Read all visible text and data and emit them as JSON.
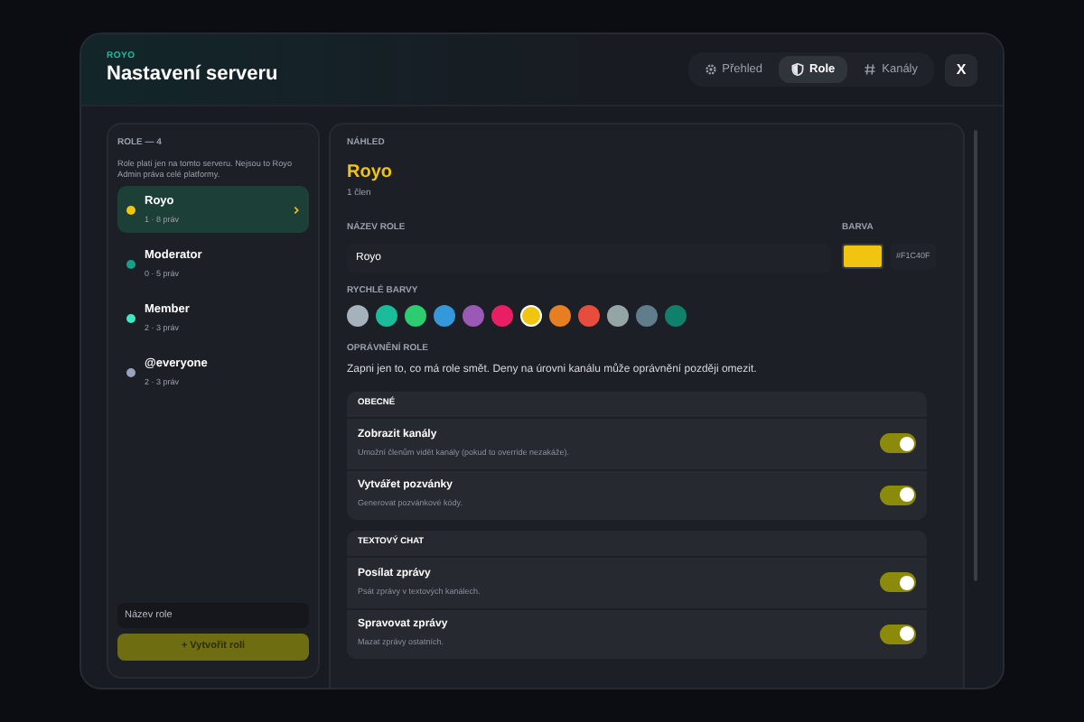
{
  "header": {
    "overline": "ROYO",
    "title": "Nastavení serveru"
  },
  "tabs": [
    {
      "label": "Přehled",
      "selected": false
    },
    {
      "label": "Role",
      "selected": true
    },
    {
      "label": "Kanály",
      "selected": false
    }
  ],
  "close": "X",
  "sidebar": {
    "heading": "ROLE — 4",
    "description": "Role platí jen na tomto serveru. Nejsou to Royo Admin práva celé platformy.",
    "roles": [
      {
        "name": "Royo",
        "meta": "1 · 8 práv",
        "color": "#f1c40f",
        "selected": true
      },
      {
        "name": "Moderator",
        "meta": "0 · 5 práv",
        "color": "#16a085",
        "selected": false
      },
      {
        "name": "Member",
        "meta": "2 · 3 práv",
        "color": "#3ee8c0",
        "selected": false
      },
      {
        "name": "@everyone",
        "meta": "2 · 3 práv",
        "color": "#99a3bd",
        "selected": false
      }
    ],
    "new_role": {
      "placeholder": "Název role"
    },
    "create_button": "+ Vytvořit roli"
  },
  "preview": {
    "label": "NÁHLED",
    "name": "Royo",
    "members": "1 člen"
  },
  "name_field": {
    "label": "NÁZEV ROLE",
    "value": "Royo"
  },
  "color_field": {
    "label": "BARVA",
    "hex": "#F1C40F"
  },
  "quick_colors": {
    "label": "RYCHLÉ BARVY",
    "swatches": [
      {
        "color": "#a5b1bd",
        "selected": false
      },
      {
        "color": "#1abc9c",
        "selected": false
      },
      {
        "color": "#2ecc71",
        "selected": false
      },
      {
        "color": "#3498db",
        "selected": false
      },
      {
        "color": "#9b59b6",
        "selected": false
      },
      {
        "color": "#e91e63",
        "selected": false
      },
      {
        "color": "#f1c40f",
        "selected": true
      },
      {
        "color": "#e67e22",
        "selected": false
      },
      {
        "color": "#e74c3c",
        "selected": false
      },
      {
        "color": "#95a5a6",
        "selected": false
      },
      {
        "color": "#607d8b",
        "selected": false
      },
      {
        "color": "#11806a",
        "selected": false
      }
    ]
  },
  "permissions": {
    "label": "OPRÁVNĚNÍ ROLE",
    "description": "Zapni jen to, co má role smět. Deny na úrovni kanálu může oprávnění později omezit.",
    "groups": [
      {
        "title": "OBECNÉ",
        "items": [
          {
            "name": "Zobrazit kanály",
            "description": "Umožní členům vidět kanály (pokud to override nezakáže).",
            "on": true
          },
          {
            "name": "Vytvářet pozvánky",
            "description": "Generovat pozvánkové kódy.",
            "on": true
          }
        ]
      },
      {
        "title": "TEXTOVÝ CHAT",
        "items": [
          {
            "name": "Posílat zprávy",
            "description": "Psát zprávy v textových kanálech.",
            "on": true
          },
          {
            "name": "Spravovat zprávy",
            "description": "Mazat zprávy ostatních.",
            "on": true
          }
        ]
      }
    ]
  }
}
